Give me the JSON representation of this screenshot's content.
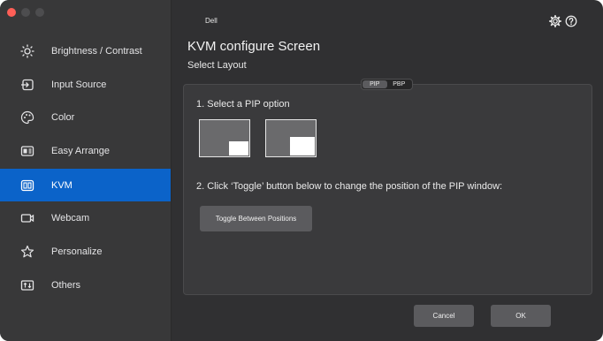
{
  "app": {
    "brand": "Dell"
  },
  "sidebar": {
    "items": [
      {
        "label": "Brightness / Contrast",
        "icon": "sun-icon"
      },
      {
        "label": "Input Source",
        "icon": "input-source-icon"
      },
      {
        "label": "Color",
        "icon": "palette-icon"
      },
      {
        "label": "Easy Arrange",
        "icon": "easy-arrange-icon"
      },
      {
        "label": "KVM",
        "icon": "kvm-icon",
        "active": true
      },
      {
        "label": "Webcam",
        "icon": "webcam-icon"
      },
      {
        "label": "Personalize",
        "icon": "star-icon"
      },
      {
        "label": "Others",
        "icon": "others-icon"
      }
    ]
  },
  "main": {
    "title": "KVM configure Screen",
    "subtitle": "Select Layout",
    "layout_tabs": [
      {
        "label": "PIP",
        "selected": true
      },
      {
        "label": "PBP",
        "selected": false
      }
    ],
    "step1": "1. Select a PIP option",
    "pip_options": [
      {
        "name": "pip-option-small"
      },
      {
        "name": "pip-option-large"
      }
    ],
    "step2": "2. Click ‘Toggle’ button below to change the position of the PIP window:",
    "toggle_label": "Toggle Between Positions",
    "cancel_label": "Cancel",
    "ok_label": "OK"
  },
  "colors": {
    "accent": "#0b63c9",
    "background": "#303032",
    "sidebar": "#383839",
    "button": "#5b5b5e"
  }
}
